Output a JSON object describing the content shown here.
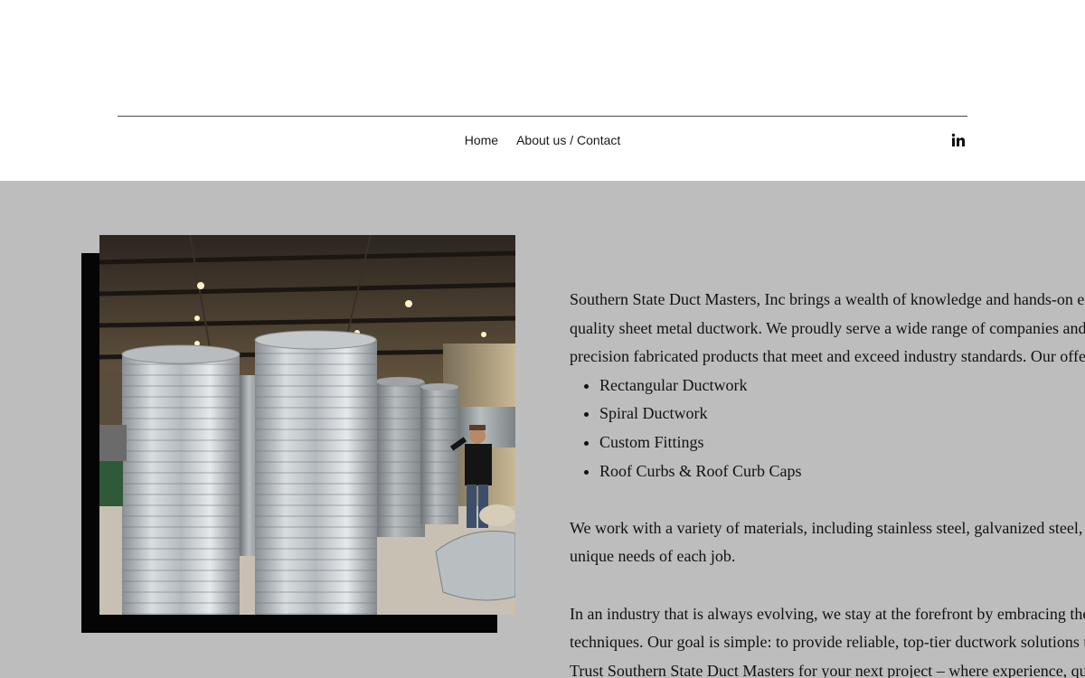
{
  "nav": {
    "home": "Home",
    "about": "About us / Contact",
    "social_icon": "linkedin-icon"
  },
  "content": {
    "intro_lines": [
      "Southern State Duct Masters, Inc brings a wealth of knowledge and hands-on e",
      "quality sheet metal ductwork. We proudly serve a wide range of companies and",
      "precision fabricated products that meet and exceed industry standards. Our offe"
    ],
    "offerings": [
      "Rectangular Ductwork",
      "Spiral Ductwork",
      "Custom Fittings",
      "Roof Curbs & Roof Curb Caps"
    ],
    "materials_lines": [
      "We work with a variety of materials, including stainless steel, galvanized steel,",
      "unique needs of each job."
    ],
    "closing_lines": [
      "In an industry that is always evolving, we stay at the forefront by embracing the",
      "techniques. Our goal is simple: to provide reliable, top-tier ductwork solutions t",
      "Trust Southern State Duct Masters for your next project – where experience, qu"
    ]
  },
  "colors": {
    "main_background": "#bdbdbd",
    "shadow_block": "#050505",
    "header_background": "#ffffff"
  }
}
